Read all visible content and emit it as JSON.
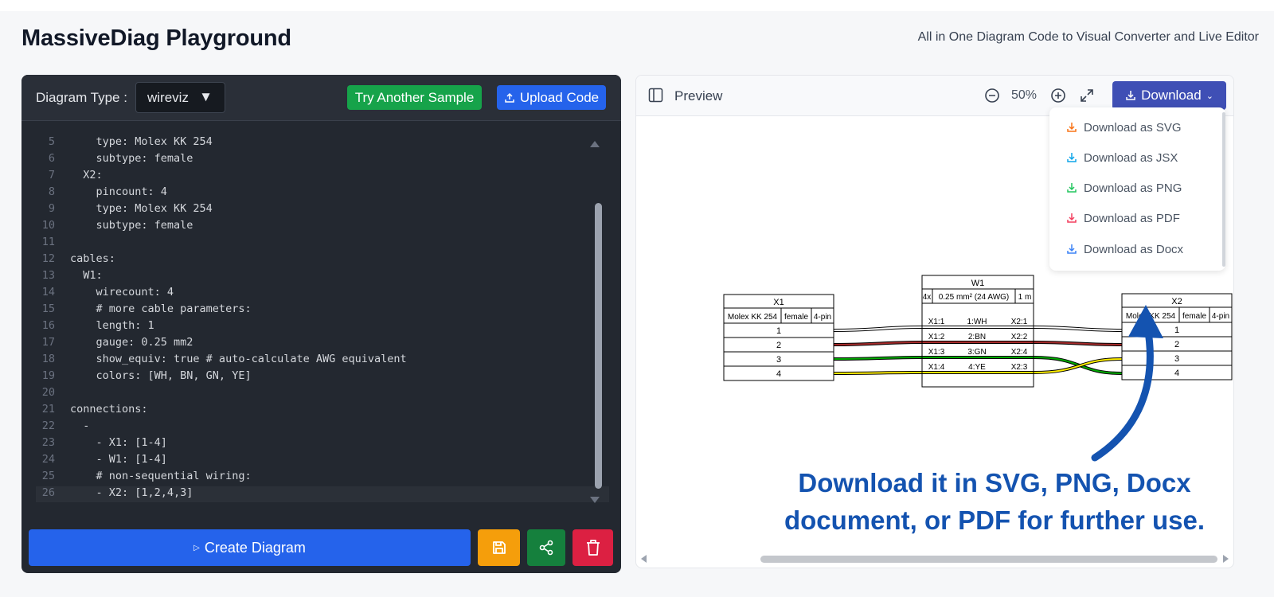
{
  "header": {
    "title": "MassiveDiag Playground",
    "subtitle": "All in One Diagram Code to Visual Converter and Live Editor"
  },
  "editor": {
    "type_label": "Diagram Type :",
    "type_value": "wireviz",
    "sample_button": "Try Another Sample",
    "upload_button": "Upload Code",
    "create_button": "Create Diagram",
    "lines": [
      {
        "n": "5",
        "t": "    type: Molex KK 254"
      },
      {
        "n": "6",
        "t": "    subtype: female"
      },
      {
        "n": "7",
        "t": "  X2:"
      },
      {
        "n": "8",
        "t": "    pincount: 4"
      },
      {
        "n": "9",
        "t": "    type: Molex KK 254"
      },
      {
        "n": "10",
        "t": "    subtype: female"
      },
      {
        "n": "11",
        "t": ""
      },
      {
        "n": "12",
        "t": "cables:"
      },
      {
        "n": "13",
        "t": "  W1:"
      },
      {
        "n": "14",
        "t": "    wirecount: 4"
      },
      {
        "n": "15",
        "t": "    # more cable parameters:"
      },
      {
        "n": "16",
        "t": "    length: 1"
      },
      {
        "n": "17",
        "t": "    gauge: 0.25 mm2"
      },
      {
        "n": "18",
        "t": "    show_equiv: true # auto-calculate AWG equivalent"
      },
      {
        "n": "19",
        "t": "    colors: [WH, BN, GN, YE]"
      },
      {
        "n": "20",
        "t": ""
      },
      {
        "n": "21",
        "t": "connections:"
      },
      {
        "n": "22",
        "t": "  -"
      },
      {
        "n": "23",
        "t": "    - X1: [1-4]"
      },
      {
        "n": "24",
        "t": "    - W1: [1-4]"
      },
      {
        "n": "25",
        "t": "    # non-sequential wiring:"
      },
      {
        "n": "26",
        "t": "    - X2: [1,2,4,3]"
      }
    ]
  },
  "preview": {
    "label": "Preview",
    "zoom": "50%",
    "download_button": "Download",
    "download_menu": [
      {
        "label": "Download as SVG",
        "color": "#f97316"
      },
      {
        "label": "Download as JSX",
        "color": "#0ea5e9"
      },
      {
        "label": "Download as PNG",
        "color": "#22c55e"
      },
      {
        "label": "Download as PDF",
        "color": "#f43f5e"
      },
      {
        "label": "Download as Docx",
        "color": "#3b82f6"
      }
    ],
    "callout_line1": "Download it in SVG, PNG, Docx",
    "callout_line2": "document, or PDF for further use."
  },
  "diagram": {
    "x1": {
      "name": "X1",
      "type": "Molex KK 254",
      "subtype": "female",
      "pins": "4-pin",
      "pin_labels": [
        "1",
        "2",
        "3",
        "4"
      ]
    },
    "x2": {
      "name": "X2",
      "type": "Molex KK 254",
      "subtype": "female",
      "pins": "4-pin",
      "pin_labels": [
        "1",
        "2",
        "3",
        "4"
      ]
    },
    "w1": {
      "name": "W1",
      "count": "4x",
      "gauge": "0.25 mm² (24 AWG)",
      "length": "1 m",
      "wires": [
        {
          "from": "X1:1",
          "color": "1:WH",
          "to": "X2:1"
        },
        {
          "from": "X1:2",
          "color": "2:BN",
          "to": "X2:2"
        },
        {
          "from": "X1:3",
          "color": "3:GN",
          "to": "X2:4"
        },
        {
          "from": "X1:4",
          "color": "4:YE",
          "to": "X2:3"
        }
      ]
    },
    "colors": {
      "WH": "#ffffff",
      "BN": "#a52a2a",
      "GN": "#00aa00",
      "YE": "#ffee00"
    }
  }
}
